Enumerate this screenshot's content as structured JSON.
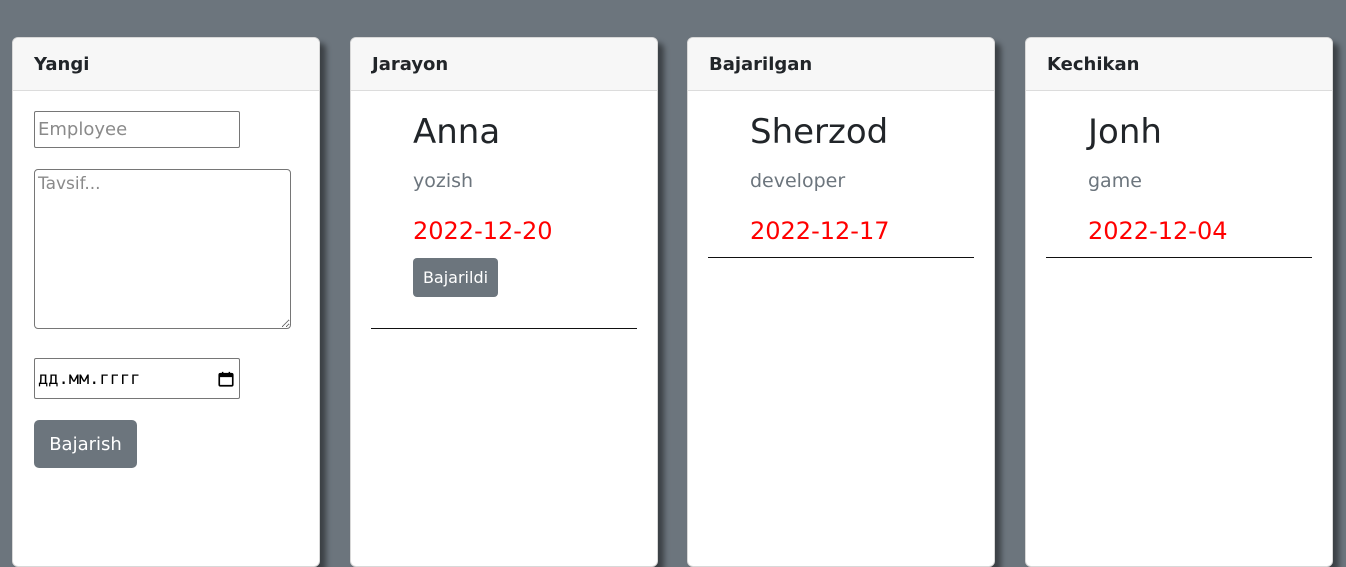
{
  "columns": {
    "new": {
      "title": "Yangi",
      "employee_placeholder": "Employee",
      "description_placeholder": "Tavsif...",
      "date_placeholder": "дд.мм.гггг",
      "submit_label": "Bajarish"
    },
    "progress": {
      "title": "Jarayon",
      "tasks": [
        {
          "name": "Anna",
          "description": "yozish",
          "date": "2022-12-20",
          "action_label": "Bajarildi"
        }
      ]
    },
    "done": {
      "title": "Bajarilgan",
      "tasks": [
        {
          "name": "Sherzod",
          "description": "developer",
          "date": "2022-12-17"
        }
      ]
    },
    "late": {
      "title": "Kechikan",
      "tasks": [
        {
          "name": "Jonh",
          "description": "game",
          "date": "2022-12-04"
        }
      ]
    }
  },
  "colors": {
    "background": "#6c757d",
    "button": "#6c757d",
    "date_text": "#ff0000",
    "muted_text": "#6c757d"
  },
  "icons": {
    "date_picker": "calendar-icon"
  }
}
